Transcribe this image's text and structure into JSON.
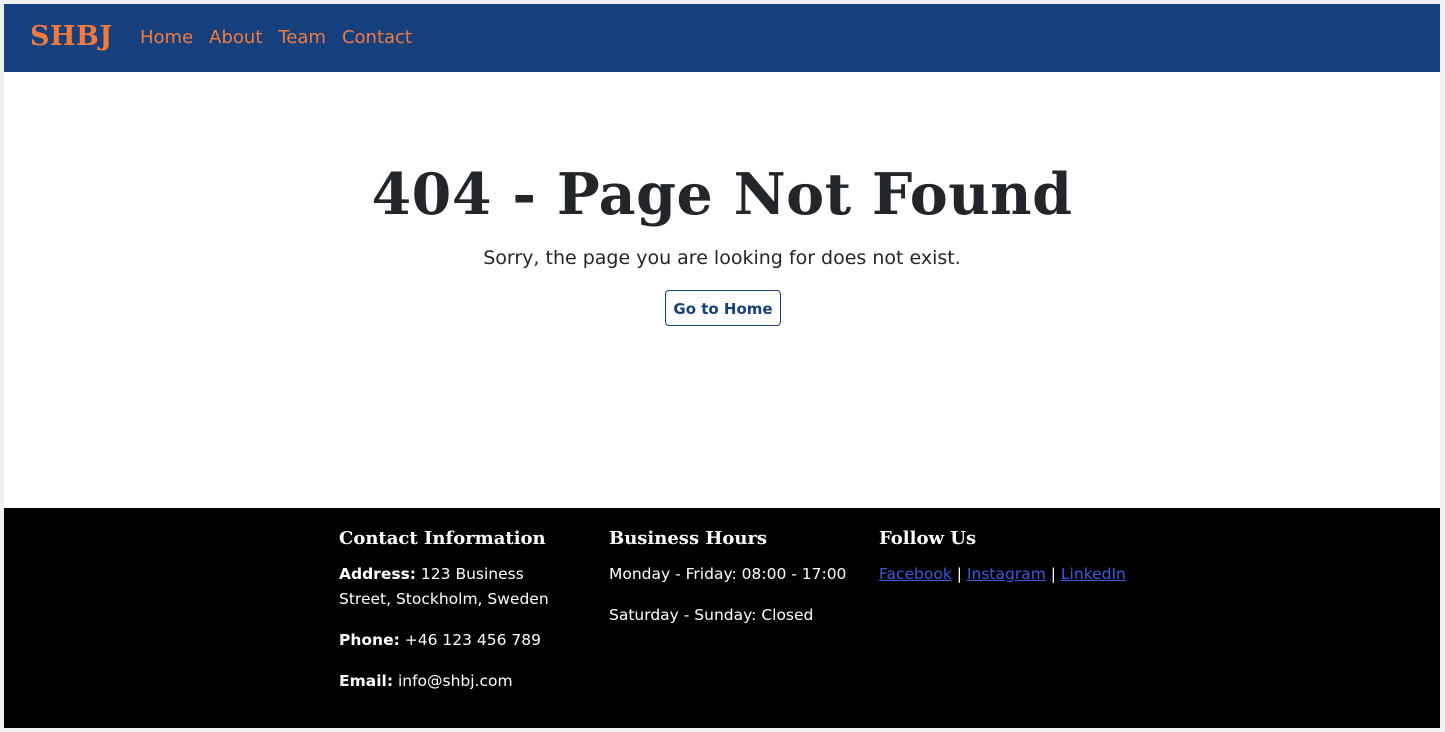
{
  "brand": "SHBJ",
  "nav": {
    "home": "Home",
    "about": "About",
    "team": "Team",
    "contact": "Contact"
  },
  "main": {
    "title": "404 - Page Not Found",
    "message": "Sorry, the page you are looking for does not exist.",
    "button_label": "Go to Home"
  },
  "footer": {
    "contact": {
      "heading": "Contact Information",
      "address_label": "Address:",
      "address_value": " 123 Business Street, Stockholm, Sweden",
      "phone_label": "Phone:",
      "phone_value": " +46 123 456 789",
      "email_label": "Email:",
      "email_value": " info@shbj.com"
    },
    "hours": {
      "heading": "Business Hours",
      "weekdays": "Monday - Friday: 08:00 - 17:00",
      "weekend": "Saturday - Sunday: Closed"
    },
    "follow": {
      "heading": "Follow Us",
      "facebook": "Facebook",
      "instagram": "Instagram",
      "linkedin": "LinkedIn",
      "separator": "|"
    }
  },
  "colors": {
    "navbar": "#17407e",
    "accent": "#f57a3a",
    "footer": "#000000",
    "link": "#3b5bdb"
  }
}
